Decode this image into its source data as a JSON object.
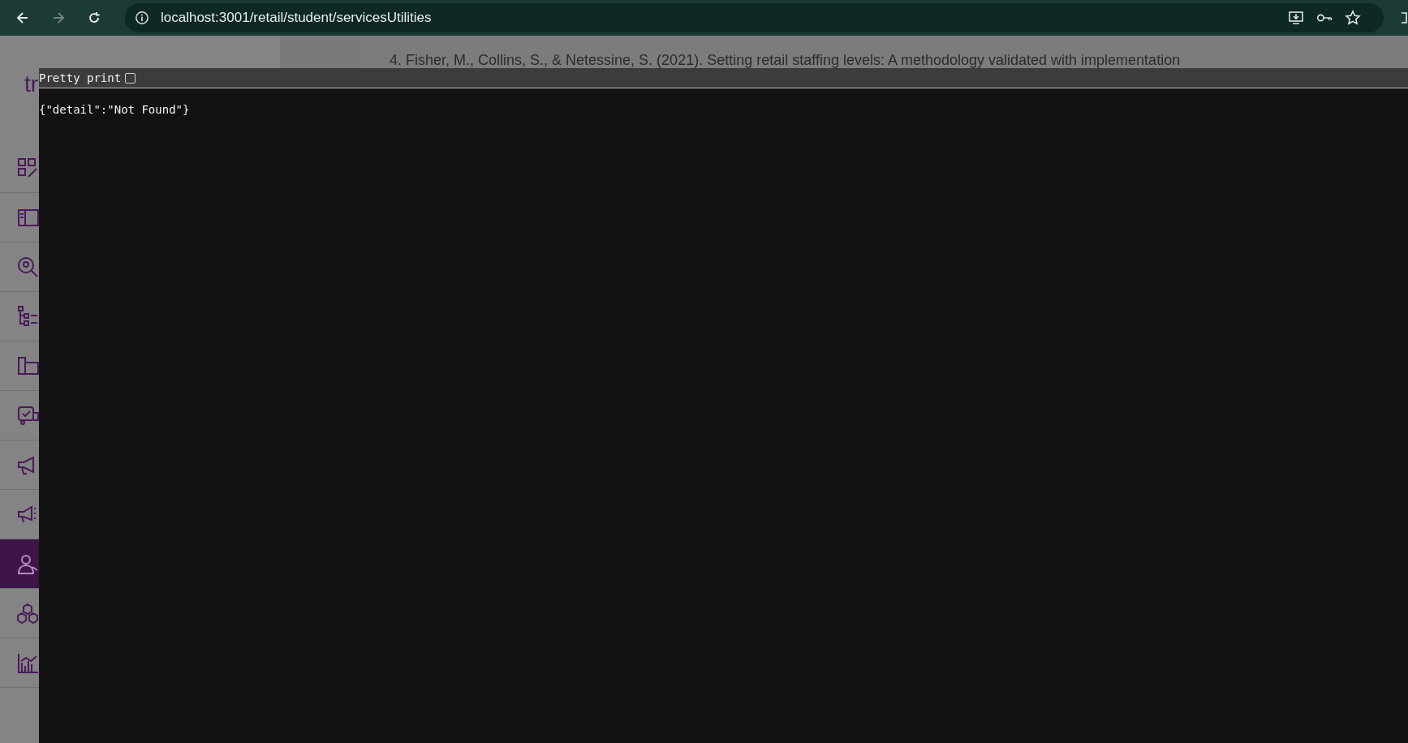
{
  "browser": {
    "url": "localhost:3001/retail/student/servicesUtilities"
  },
  "page": {
    "logo": "tr",
    "reference": "4. Fisher, M., Collins, S., & Netessine, S. (2021). Setting retail staffing levels: A methodology validated with implementation"
  },
  "sidebar": {
    "items": [
      {
        "selected": false
      },
      {
        "selected": false
      },
      {
        "selected": false
      },
      {
        "selected": false
      },
      {
        "selected": false
      },
      {
        "selected": false
      },
      {
        "selected": false
      },
      {
        "selected": false
      },
      {
        "selected": true
      },
      {
        "selected": false
      },
      {
        "selected": false
      }
    ]
  },
  "json_viewer": {
    "pretty_print": {
      "label": "Pretty print",
      "checked": false
    },
    "body": "{\"detail\":\"Not Found\"}"
  }
}
